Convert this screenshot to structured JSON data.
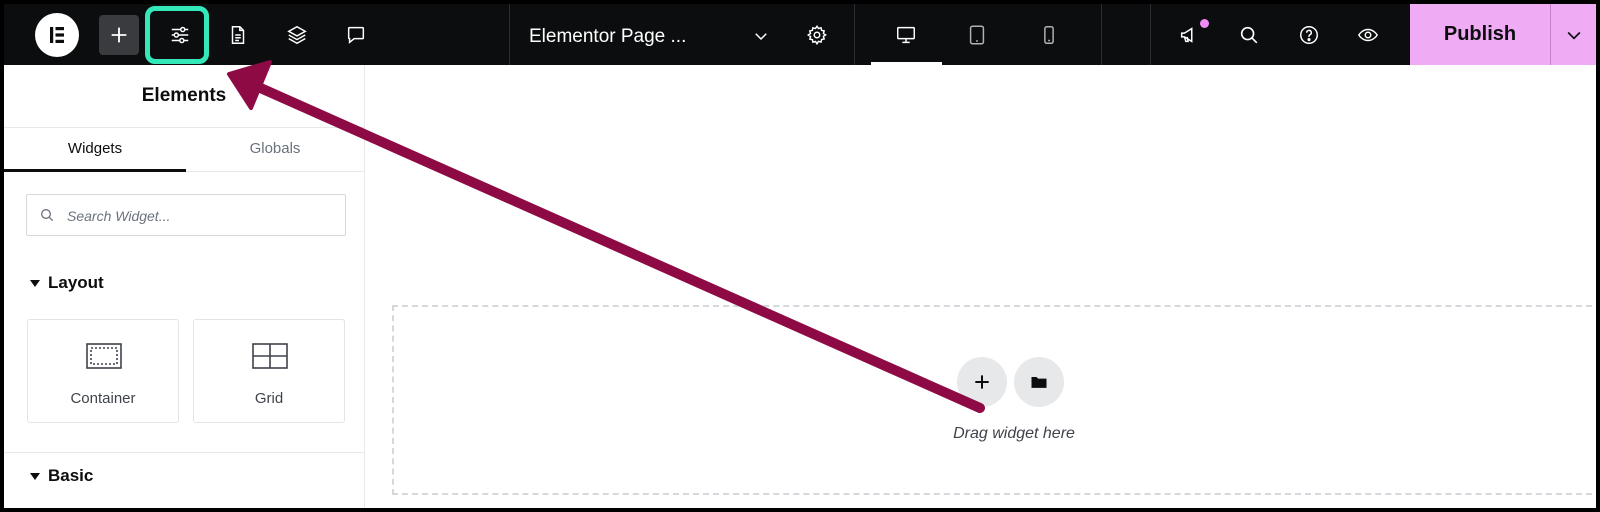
{
  "topbar": {
    "page_title": "Elementor Page ...",
    "publish_label": "Publish"
  },
  "panel": {
    "title": "Elements",
    "tabs": [
      {
        "label": "Widgets",
        "active": true
      },
      {
        "label": "Globals",
        "active": false
      }
    ],
    "search": {
      "placeholder": "Search Widget..."
    },
    "sections": [
      {
        "title": "Layout",
        "widgets": [
          {
            "label": "Container",
            "icon": "container-icon"
          },
          {
            "label": "Grid",
            "icon": "grid-icon"
          }
        ]
      },
      {
        "title": "Basic"
      }
    ]
  },
  "canvas": {
    "drop_text": "Drag widget here"
  },
  "colors": {
    "topbar_bg": "#0c0d0e",
    "publish_bg": "#f0abf5",
    "highlight": "#35e8b9",
    "annotation_arrow": "#8e0a45"
  }
}
